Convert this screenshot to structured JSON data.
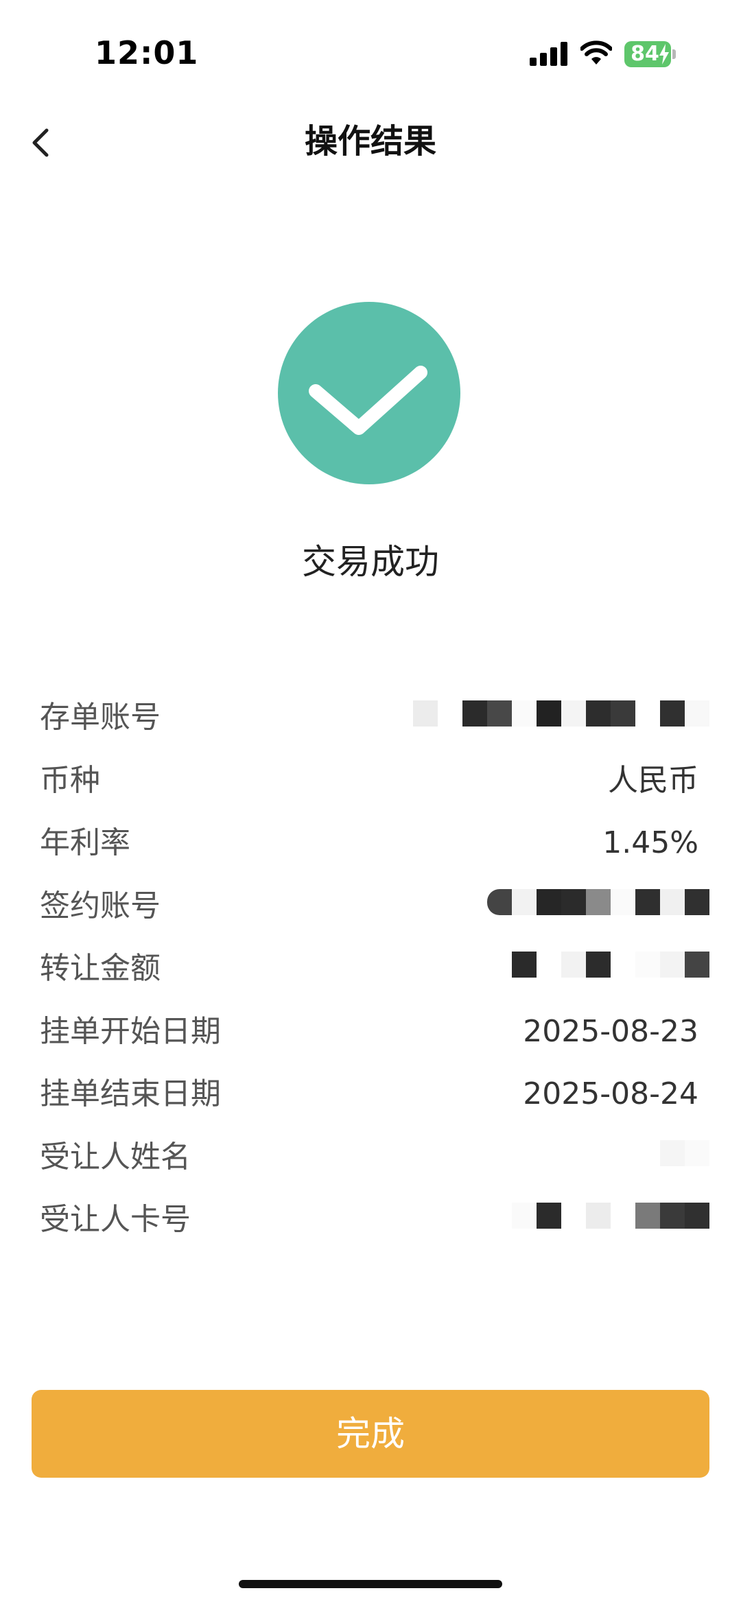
{
  "status_bar": {
    "time": "12:01",
    "battery_level": "84",
    "icons": [
      "signal-icon",
      "wifi-icon",
      "battery-icon"
    ],
    "battery_color": "#5ec66b"
  },
  "nav": {
    "back_icon": "chevron-left-icon",
    "title": "操作结果"
  },
  "result": {
    "icon": "check-circle-icon",
    "icon_color": "#5bbfaa",
    "text": "交易成功"
  },
  "details": [
    {
      "label": "存单账号",
      "value": "",
      "redacted": true
    },
    {
      "label": "币种",
      "value": "人民币",
      "redacted": false
    },
    {
      "label": "年利率",
      "value": "1.45%",
      "redacted": false
    },
    {
      "label": "签约账号",
      "value": "",
      "redacted": true
    },
    {
      "label": "转让金额",
      "value": "",
      "redacted": true
    },
    {
      "label": "挂单开始日期",
      "value": "2025-08-23",
      "redacted": false
    },
    {
      "label": "挂单结束日期",
      "value": "2025-08-24",
      "redacted": false
    },
    {
      "label": "受让人姓名",
      "value": "",
      "redacted": true
    },
    {
      "label": "受让人卡号",
      "value": "",
      "redacted": true
    }
  ],
  "done_button": {
    "label": "完成",
    "color": "#f0ad3d"
  }
}
